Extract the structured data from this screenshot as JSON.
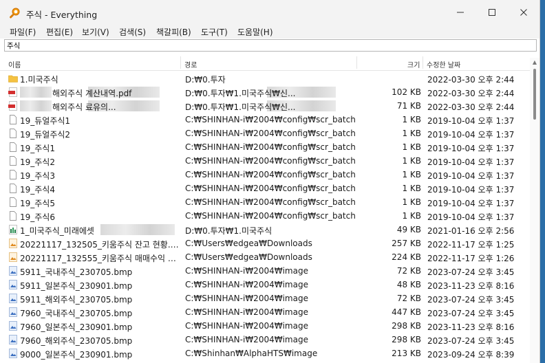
{
  "window": {
    "title": "주식 - Everything"
  },
  "menu": [
    "파일(F)",
    "편집(E)",
    "보기(V)",
    "검색(S)",
    "책갈피(B)",
    "도구(T)",
    "도움말(H)"
  ],
  "search": {
    "value": "주식"
  },
  "columns": {
    "name": "이름",
    "path": "경로",
    "size": "크기",
    "date": "수정한 날짜"
  },
  "rows": [
    {
      "icon": "folder-icon",
      "name": "1.미국주식",
      "path": "D:₩0.투자",
      "size": "",
      "date": "2022-03-30 오후 2:44"
    },
    {
      "icon": "pdf-icon",
      "name": "해외주식 계산내역.pdf",
      "path": "D:₩0.투자₩1.미국주식₩신...",
      "size": "102 KB",
      "date": "2022-03-30 오후 2:44"
    },
    {
      "icon": "pdf-icon",
      "name": "해외주식 료유의...",
      "path": "D:₩0.투자₩1.미국주식₩신...",
      "size": "71 KB",
      "date": "2022-03-30 오후 2:44"
    },
    {
      "icon": "file-icon",
      "name": "19_듀얼주식1",
      "path": "C:₩SHINHAN-i₩2004₩config₩scr_batch",
      "size": "1 KB",
      "date": "2019-10-04 오후 1:37"
    },
    {
      "icon": "file-icon",
      "name": "19_듀얼주식2",
      "path": "C:₩SHINHAN-i₩2004₩config₩scr_batch",
      "size": "1 KB",
      "date": "2019-10-04 오후 1:37"
    },
    {
      "icon": "file-icon",
      "name": "19_주식1",
      "path": "C:₩SHINHAN-i₩2004₩config₩scr_batch",
      "size": "1 KB",
      "date": "2019-10-04 오후 1:37"
    },
    {
      "icon": "file-icon",
      "name": "19_주식2",
      "path": "C:₩SHINHAN-i₩2004₩config₩scr_batch",
      "size": "1 KB",
      "date": "2019-10-04 오후 1:37"
    },
    {
      "icon": "file-icon",
      "name": "19_주식3",
      "path": "C:₩SHINHAN-i₩2004₩config₩scr_batch",
      "size": "1 KB",
      "date": "2019-10-04 오후 1:37"
    },
    {
      "icon": "file-icon",
      "name": "19_주식4",
      "path": "C:₩SHINHAN-i₩2004₩config₩scr_batch",
      "size": "1 KB",
      "date": "2019-10-04 오후 1:37"
    },
    {
      "icon": "file-icon",
      "name": "19_주식5",
      "path": "C:₩SHINHAN-i₩2004₩config₩scr_batch",
      "size": "1 KB",
      "date": "2019-10-04 오후 1:37"
    },
    {
      "icon": "file-icon",
      "name": "19_주식6",
      "path": "C:₩SHINHAN-i₩2004₩config₩scr_batch",
      "size": "1 KB",
      "date": "2019-10-04 오후 1:37"
    },
    {
      "icon": "excel-icon",
      "name": "1_미국주식_미래에셋",
      "path": "D:₩0.투자₩1.미국주식",
      "size": "49 KB",
      "date": "2021-01-16 오후 2:56"
    },
    {
      "icon": "jpg-icon",
      "name": "20221117_132505_키움주식 잔고 현황.jpg",
      "path": "C:₩Users₩edgea₩Downloads",
      "size": "257 KB",
      "date": "2022-11-17 오후 1:25"
    },
    {
      "icon": "jpg-icon",
      "name": "20221117_132555_키움주식 매매수익 현...",
      "path": "C:₩Users₩edgea₩Downloads",
      "size": "224 KB",
      "date": "2022-11-17 오후 1:26"
    },
    {
      "icon": "bmp-icon",
      "name": "5911_국내주식_230705.bmp",
      "path": "C:₩SHINHAN-i₩2004₩image",
      "size": "72 KB",
      "date": "2023-07-24 오후 3:45"
    },
    {
      "icon": "bmp-icon",
      "name": "5911_일본주식_230901.bmp",
      "path": "C:₩SHINHAN-i₩2004₩image",
      "size": "48 KB",
      "date": "2023-11-23 오후 8:16"
    },
    {
      "icon": "bmp-icon",
      "name": "5911_해외주식_230705.bmp",
      "path": "C:₩SHINHAN-i₩2004₩image",
      "size": "72 KB",
      "date": "2023-07-24 오후 3:45"
    },
    {
      "icon": "bmp-icon",
      "name": "7960_국내주식_230705.bmp",
      "path": "C:₩SHINHAN-i₩2004₩image",
      "size": "447 KB",
      "date": "2023-07-24 오후 3:45"
    },
    {
      "icon": "bmp-icon",
      "name": "7960_일본주식_230901.bmp",
      "path": "C:₩SHINHAN-i₩2004₩image",
      "size": "298 KB",
      "date": "2023-11-23 오후 8:16"
    },
    {
      "icon": "bmp-icon",
      "name": "7960_해외주식_230705.bmp",
      "path": "C:₩SHINHAN-i₩2004₩image",
      "size": "298 KB",
      "date": "2023-07-24 오후 3:45"
    },
    {
      "icon": "bmp-icon",
      "name": "9000_일본주식_230901.bmp",
      "path": "C:₩Shinhan₩AlphaHTS₩image",
      "size": "213 KB",
      "date": "2023-09-24 오후 8:39"
    }
  ]
}
